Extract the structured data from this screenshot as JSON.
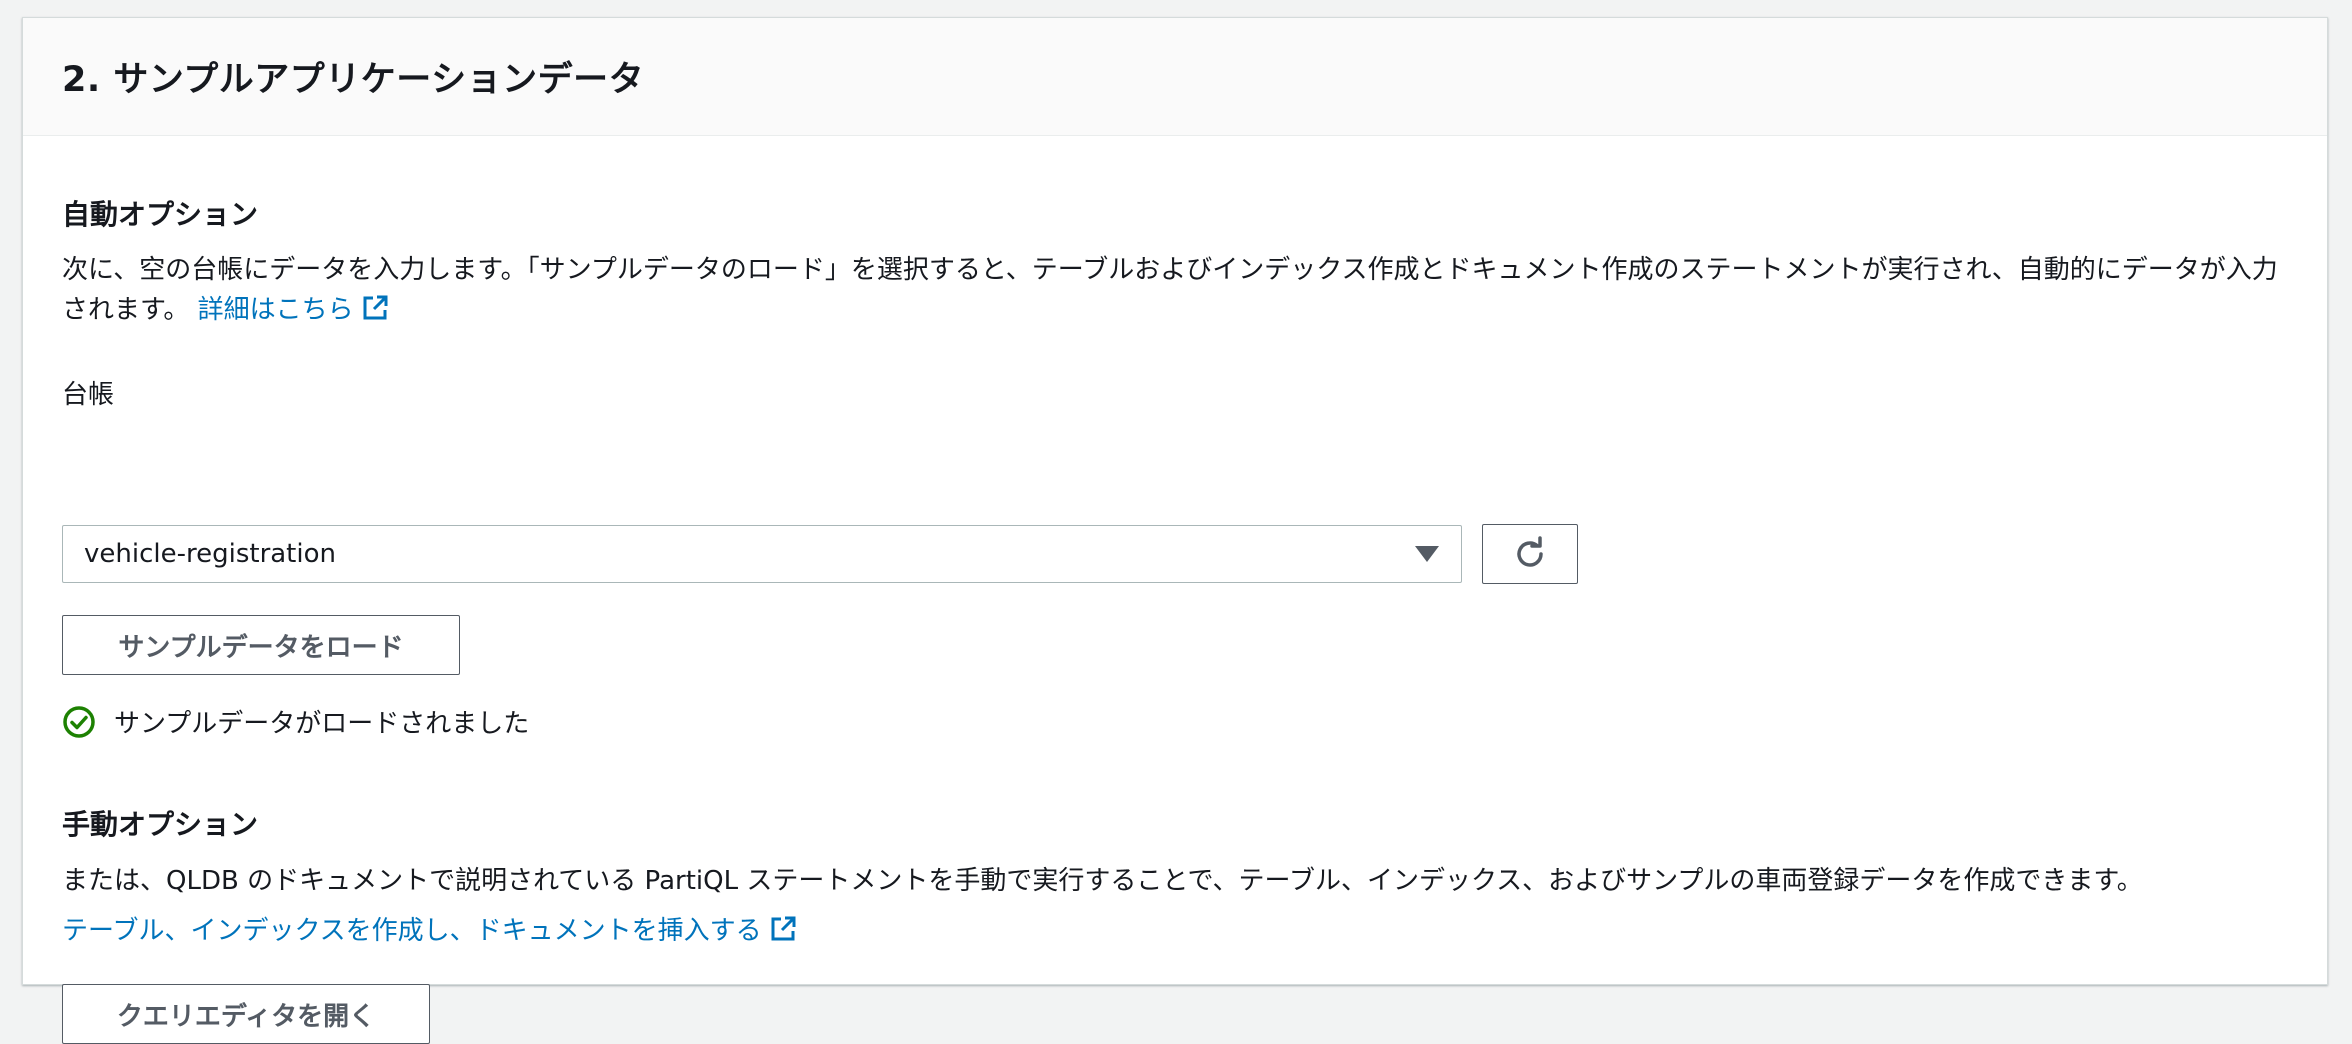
{
  "panel": {
    "title": "2. サンプルアプリケーションデータ"
  },
  "auto_option": {
    "heading": "自動オプション",
    "description": "次に、空の台帳にデータを入力します。「サンプルデータのロード」を選択すると、テーブルおよびインデックス作成とドキュメント作成のステートメントが実行され、自動的にデータが入力されます。",
    "learn_more_link": "詳細はこちら",
    "ledger_label": "台帳",
    "ledger_selected": "vehicle-registration",
    "load_button": "サンプルデータをロード",
    "status_text": "サンプルデータがロードされました"
  },
  "manual_option": {
    "heading": "手動オプション",
    "description": "または、QLDB のドキュメントで説明されている PartiQL ステートメントを手動で実行することで、テーブル、インデックス、およびサンプルの車両登録データを作成できます。",
    "docs_link": "テーブル、インデックスを作成し、ドキュメントを挿入する",
    "query_editor_button": "クエリエディタを開く"
  },
  "icons": {
    "external_link": "external-link-icon",
    "refresh": "refresh-icon",
    "dropdown": "caret-down-icon",
    "success": "status-success-icon"
  },
  "colors": {
    "link": "#0073bb",
    "success": "#1d8102",
    "button_text": "#545b64"
  }
}
